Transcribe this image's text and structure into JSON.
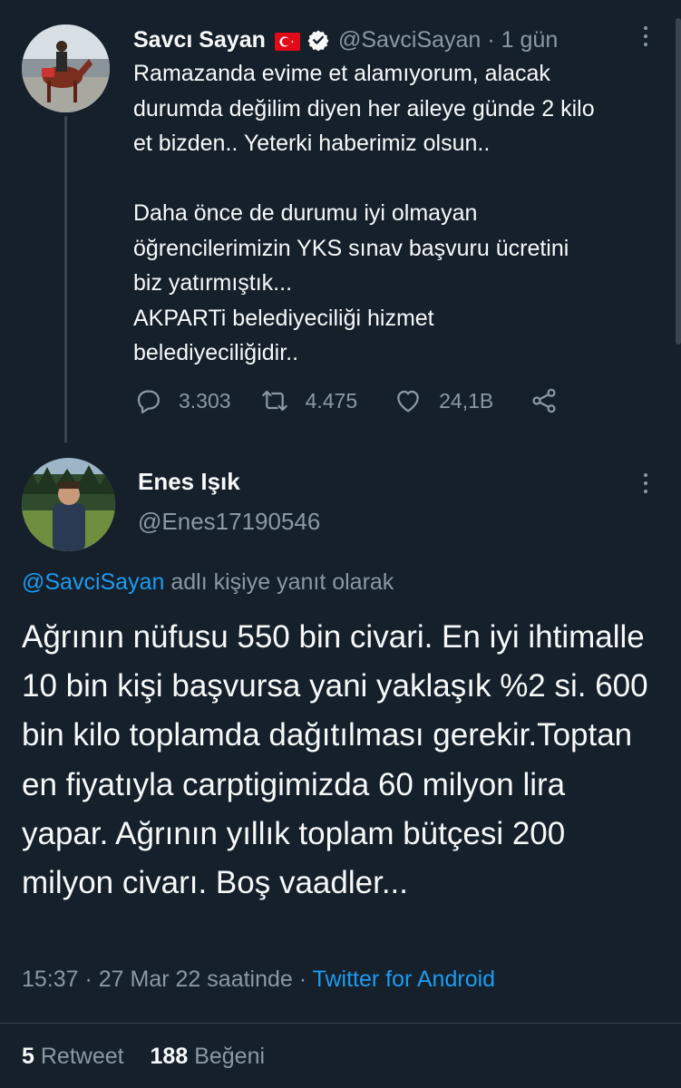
{
  "parent_tweet": {
    "author_name": "Savcı Sayan",
    "handle": "@SavciSayan",
    "separator": "·",
    "time": "1 gün",
    "text_lines": [
      "Ramazanda evime et alamıyorum, alacak",
      "durumda değilim diyen her aileye günde 2 kilo",
      "et bizden.. Yeterki haberimiz olsun..",
      "",
      "Daha önce de durumu iyi olmayan",
      "öğrencilerimizin YKS sınav başvuru ücretini",
      "biz yatırmıştık...",
      "AKPARTi belediyeciliği hizmet",
      "belediyeciliğidir.."
    ],
    "reply_count": "3.303",
    "retweet_count": "4.475",
    "like_count": "24,1B",
    "icons": {
      "flag": "turkey-flag-icon",
      "verified": "verified-badge-icon",
      "reply": "reply-icon",
      "retweet": "retweet-icon",
      "like": "heart-icon",
      "share": "share-icon",
      "more": "more-vertical-icon"
    }
  },
  "reply_tweet": {
    "author_name": "Enes Işık",
    "handle": "@Enes17190546",
    "replying_mention": "@SavciSayan",
    "replying_suffix": " adlı kişiye yanıt olarak",
    "text": "Ağrının nüfusu 550 bin civari. En iyi ihtimalle 10 bin kişi başvursa yani yaklaşık %2 si. 600 bin kilo toplamda dağıtılması gerekir.Toptan en fiyatıyla carptigimizda 60 milyon lira yapar. Ağrının yıllık toplam bütçesi 200 milyon civarı. Boş vaadler...",
    "timestamp": "15:37 · 27 Mar 22 saatinde",
    "meta_separator": " · ",
    "source": "Twitter for Android",
    "retweets_count": "5",
    "retweets_label": "Retweet",
    "likes_count": "188",
    "likes_label": "Beğeni"
  },
  "colors": {
    "background": "#15202b",
    "primary_text": "#f7f9f9",
    "secondary_text": "#8b98a5",
    "accent": "#1d9bf0",
    "divider": "#38444d"
  }
}
